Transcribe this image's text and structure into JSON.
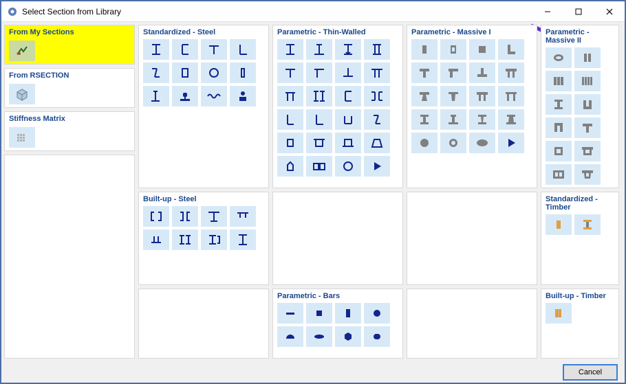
{
  "window": {
    "title": "Select Section from Library"
  },
  "panels": {
    "std_steel": "Standardized - Steel",
    "thin_walled": "Parametric - Thin-Walled",
    "massive1": "Parametric - Massive I",
    "massive2": "Parametric - Massive II",
    "builtup_steel": "Built-up - Steel",
    "std_timber": "Standardized - Timber",
    "bars": "Parametric - Bars",
    "builtup_timber": "Built-up - Timber",
    "my_sections": "From My Sections",
    "rsection": "From RSECTION",
    "stiffness": "Stiffness Matrix"
  },
  "footer": {
    "cancel": "Cancel"
  },
  "colors": {
    "steel": "#12268c",
    "massive": "#808080",
    "timber": "#e0a040",
    "highlight": "#ffff00"
  }
}
